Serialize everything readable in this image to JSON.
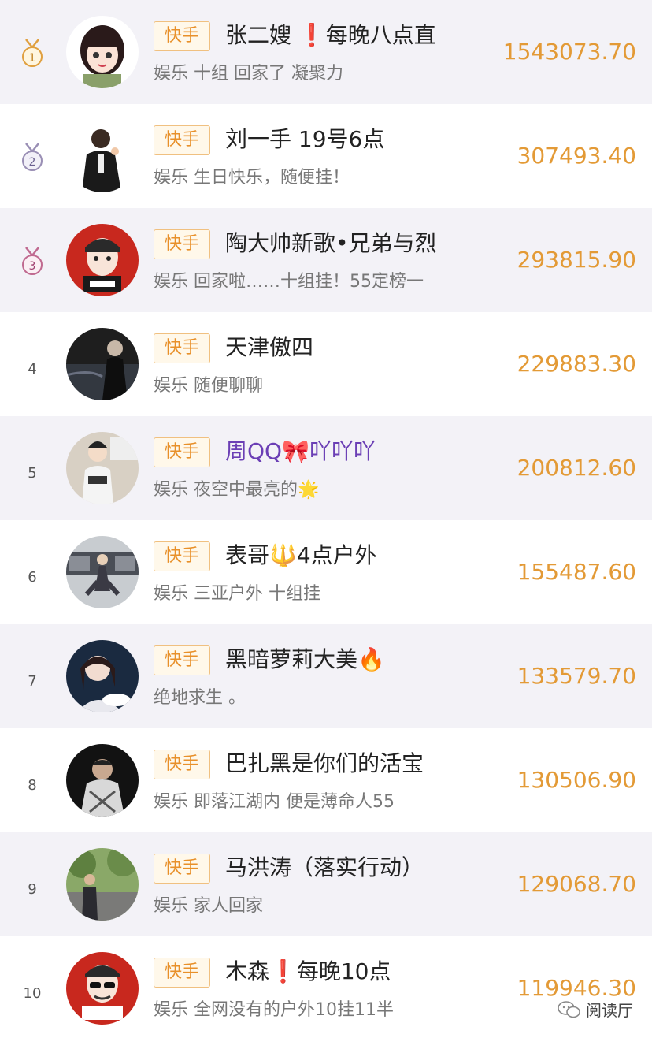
{
  "rows": [
    {
      "rank": "1",
      "platform": "快手",
      "name": "张二嫂 ❗每晚八点直",
      "desc": "娱乐 十组 回家了 凝聚力",
      "score": "1543073.70",
      "medal": "gold"
    },
    {
      "rank": "2",
      "platform": "快手",
      "name": "刘一手 19号6点",
      "desc": "娱乐 生日快乐，随便挂！",
      "score": "307493.40",
      "medal": "silver"
    },
    {
      "rank": "3",
      "platform": "快手",
      "name": "陶大帅新歌•兄弟与烈",
      "desc": "娱乐 回家啦……十组挂！55定榜一",
      "score": "293815.90",
      "medal": "bronze"
    },
    {
      "rank": "4",
      "platform": "快手",
      "name": "天津傲四",
      "desc": "娱乐 随便聊聊",
      "score": "229883.30"
    },
    {
      "rank": "5",
      "platform": "快手",
      "name": "周QQ🎀吖吖吖",
      "desc": "娱乐 夜空中最亮的🌟",
      "score": "200812.60"
    },
    {
      "rank": "6",
      "platform": "快手",
      "name": "表哥🔱4点户外",
      "desc": "娱乐 三亚户外 十组挂",
      "score": "155487.60"
    },
    {
      "rank": "7",
      "platform": "快手",
      "name": "黑暗萝莉大美🔥",
      "desc": "绝地求生 。",
      "score": "133579.70"
    },
    {
      "rank": "8",
      "platform": "快手",
      "name": "巴扎黑是你们的活宝",
      "desc": "娱乐 即落江湖内 便是薄命人55",
      "score": "130506.90"
    },
    {
      "rank": "9",
      "platform": "快手",
      "name": "马洪涛（落实行动）",
      "desc": "娱乐 家人回家",
      "score": "129068.70"
    },
    {
      "rank": "10",
      "platform": "快手",
      "name": "木森❗每晚10点",
      "desc": "娱乐 全网没有的户外10挂11半",
      "score": "119946.30"
    }
  ],
  "watermark": "阅读厅",
  "colors": {
    "accent": "#e39a36",
    "tag_border": "#f0c080",
    "row_alt": "#f3f2f7",
    "name_purple": "#6b3fb5"
  }
}
